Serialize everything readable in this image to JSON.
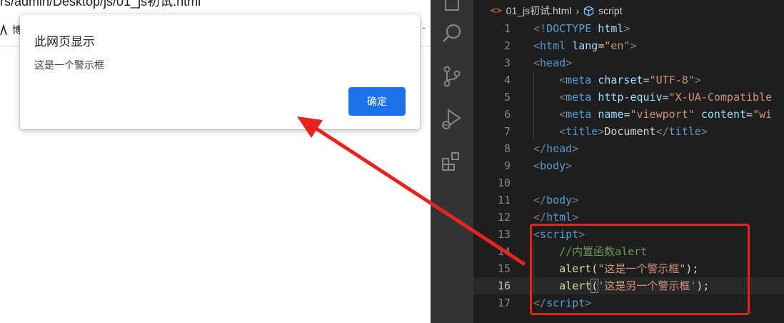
{
  "browser": {
    "url_fragment": "rs/admin/Desktop/js/01_js初试.html",
    "bookmark_label": "博",
    "bookmark_overflow": "| -"
  },
  "dialog": {
    "title": "此网页显示",
    "message": "这是一个警示框",
    "ok_label": "确定"
  },
  "activity_bar": {
    "icons": [
      "files-icon",
      "search-icon",
      "source-control-icon",
      "run-debug-icon",
      "extensions-icon"
    ]
  },
  "editor": {
    "breadcrumb": {
      "file": "01_js初试.html",
      "symbol": "script"
    },
    "active_line": 16,
    "lines": [
      {
        "n": "1"
      },
      {
        "n": "2"
      },
      {
        "n": "3"
      },
      {
        "n": "4"
      },
      {
        "n": "5"
      },
      {
        "n": "6"
      },
      {
        "n": "7"
      },
      {
        "n": "8"
      },
      {
        "n": "9"
      },
      {
        "n": "10"
      },
      {
        "n": "11"
      },
      {
        "n": "12"
      },
      {
        "n": "13"
      },
      {
        "n": "14"
      },
      {
        "n": "15"
      },
      {
        "n": "16"
      },
      {
        "n": "17"
      }
    ],
    "code": {
      "l1_a": "<!",
      "l1_b": "DOCTYPE",
      "l1_c": " html",
      "l1_d": ">",
      "l2_tag": "html",
      "l2_attr": "lang",
      "l2_val": "\"en\"",
      "l3_tag": "head",
      "l4_tag": "meta",
      "l4_attr": "charset",
      "l4_val": "\"UTF-8\"",
      "l5_tag": "meta",
      "l5_attr": "http-equiv",
      "l5_val": "\"X-UA-Compatible",
      "l6_tag": "meta",
      "l6_attr": "name",
      "l6_val": "\"viewport\"",
      "l6_attr2": "content",
      "l6_val2": "\"wi",
      "l7_tag": "title",
      "l7_text": "Document",
      "l7_end": "title",
      "l8_tag": "head",
      "l9_tag": "body",
      "l11_tag": "body",
      "l12_tag": "html",
      "l13_tag": "script",
      "l14_comment": "//内置函数alert",
      "l15_fn": "alert",
      "l15_str": "\"这是一个警示框\"",
      "l15_end": ");",
      "l16_fn": "alert",
      "l16_str": "'这是另一个警示框'",
      "l16_end": ");",
      "l17_tag": "script"
    }
  },
  "colors": {
    "annotation": "#e8231e",
    "dialog_button": "#1a73e8",
    "editor_bg": "#1e1e1e",
    "activity_bg": "#333333"
  }
}
